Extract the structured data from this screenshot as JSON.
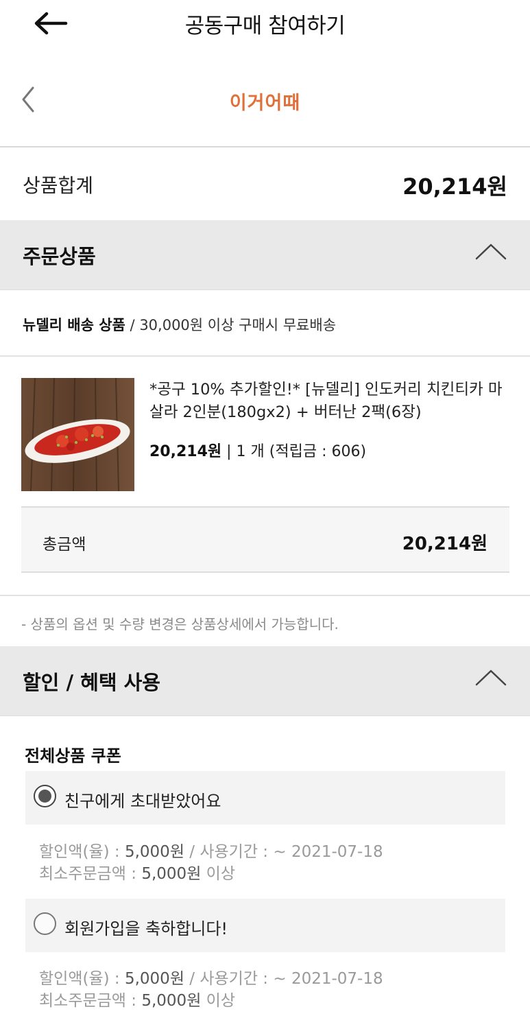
{
  "header": {
    "title": "공동구매 참여하기",
    "back_icon": "arrow-left-icon"
  },
  "shop": {
    "logo_text": "이거어때",
    "logo_color": "#e0703a",
    "prev_icon": "chevron-left-icon"
  },
  "summary": {
    "label": "상품합계",
    "value": "20,214원"
  },
  "order_section": {
    "title": "주문상품",
    "toggle_icon": "chevron-up-icon"
  },
  "shipping": {
    "vendor": "뉴델리 배송 상품",
    "separator": " / ",
    "condition": "30,000원 이상 구매시 무료배송"
  },
  "product": {
    "name": "*공구 10% 추가할인!* [뉴델리] 인도커리 치킨티카 마살라 2인분(180gx2) + 버터난 2팩(6장)",
    "price": "20,214원",
    "separator": " | ",
    "quantity": "1 개",
    "points": "(적립금 : 606)"
  },
  "total": {
    "label": "총금액",
    "value": "20,214원"
  },
  "note": "- 상품의 옵션 및 수량 변경은 상품상세에서 가능합니다.",
  "discount_section": {
    "title": "할인 / 혜택 사용",
    "toggle_icon": "chevron-up-icon"
  },
  "coupons": {
    "heading": "전체상품 쿠폰",
    "items": [
      {
        "name": "친구에게 초대받았어요",
        "selected": true,
        "discount_label": "할인액(율) : ",
        "discount_value": "5,000원",
        "period_label": " / 사용기간 : ~ 2021-07-18",
        "min_label": "최소주문금액 : ",
        "min_value": "5,000원",
        "min_suffix": " 이상"
      },
      {
        "name": "회원가입을 축하합니다!",
        "selected": false,
        "discount_label": "할인액(율) : ",
        "discount_value": "5,000원",
        "period_label": " / 사용기간 : ~ 2021-07-18",
        "min_label": "최소주문금액 : ",
        "min_value": "5,000원",
        "min_suffix": " 이상"
      }
    ]
  }
}
